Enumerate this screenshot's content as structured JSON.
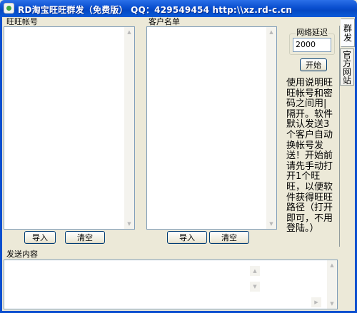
{
  "window": {
    "title": "RD淘宝旺旺群发（免费版） QQ：429549454 http:\\\\xz.rd-c.cn"
  },
  "left_panel": {
    "label": "旺旺帐号",
    "import_label": "导入",
    "clear_label": "清空"
  },
  "middle_panel": {
    "label": "客户名单",
    "import_label": "导入",
    "clear_label": "清空"
  },
  "delay": {
    "label": "网络延迟",
    "value": "2000"
  },
  "start_label": "开始",
  "description": "使用说明旺旺帐号和密码之间用|隔开。软件默认发送3个客户自动换帐号发送！开始前请先手动打开1个旺旺，以便软件获得旺旺路径（打开即可，不用登陆。）",
  "tabs": [
    {
      "label": "群发"
    },
    {
      "label": "官方网站"
    }
  ],
  "send": {
    "label": "发送内容"
  },
  "colors": {
    "titlebar": "#0a4fcf",
    "face": "#ece9d8",
    "list_border": "#7f9db9"
  }
}
